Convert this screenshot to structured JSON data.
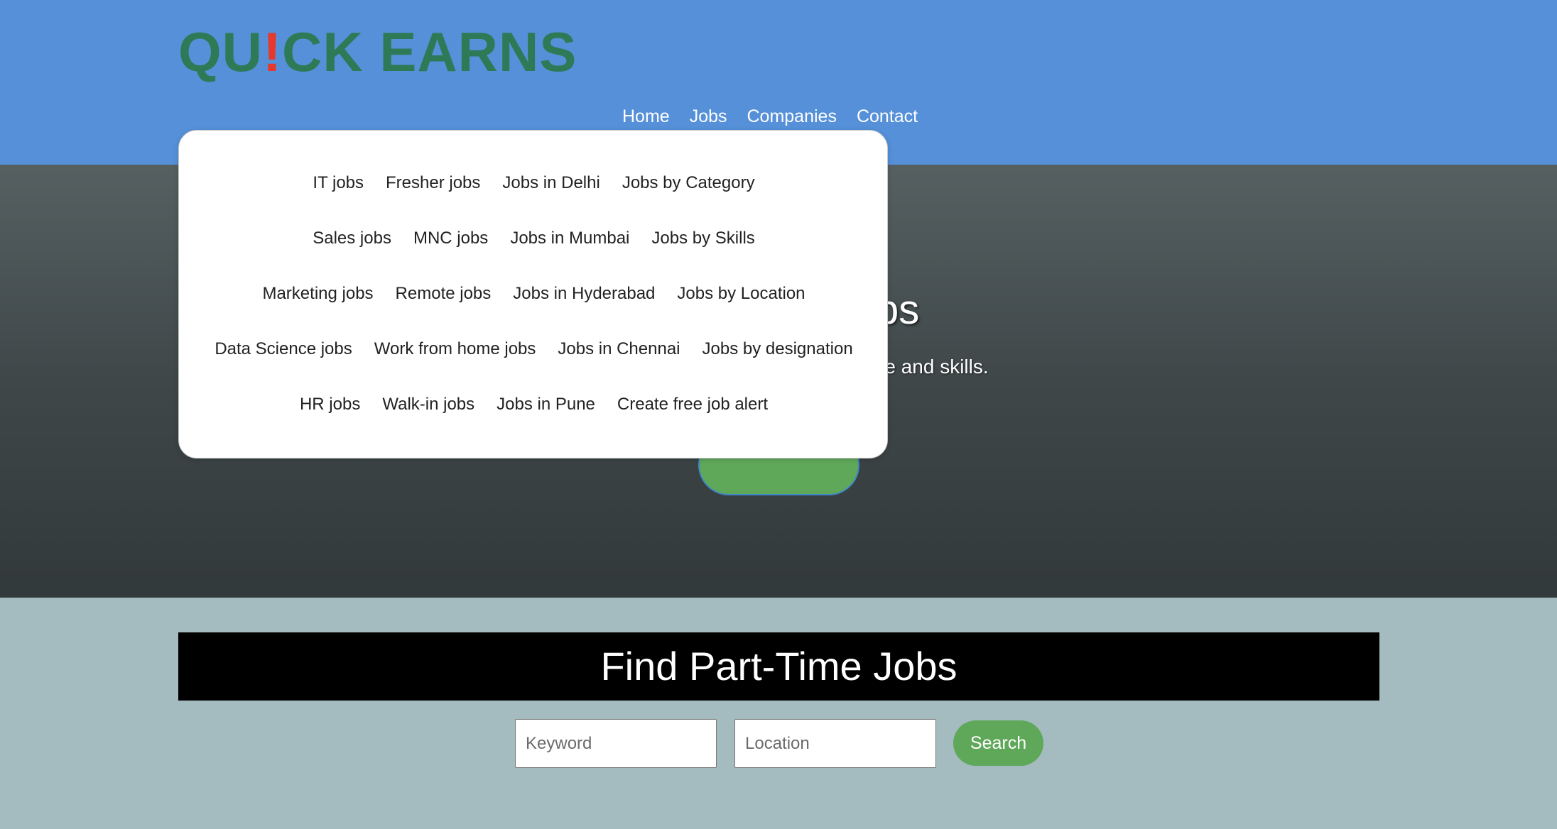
{
  "header": {
    "logo_prefix": "QU",
    "logo_bang": "!",
    "logo_suffix": "CK EARNS",
    "nav": [
      "Home",
      "Jobs",
      "Companies",
      "Contact"
    ]
  },
  "hero": {
    "title_visible": "me Jobs",
    "subtitle_visible": "dule and skills."
  },
  "dropdown": {
    "rows": [
      [
        "IT jobs",
        "Fresher jobs",
        "Jobs in Delhi",
        "Jobs by Category"
      ],
      [
        "Sales jobs",
        "MNC jobs",
        "Jobs in Mumbai",
        "Jobs by Skills"
      ],
      [
        "Marketing jobs",
        "Remote jobs",
        "Jobs in Hyderabad",
        "Jobs by Location"
      ],
      [
        "Data Science jobs",
        "Work from home jobs",
        "Jobs in Chennai",
        "Jobs by designation"
      ],
      [
        "HR jobs",
        "Walk-in jobs",
        "Jobs in Pune",
        "Create free job alert"
      ]
    ]
  },
  "search": {
    "title": "Find Part-Time Jobs",
    "keyword_placeholder": "Keyword",
    "location_placeholder": "Location",
    "button_label": "Search"
  },
  "colors": {
    "header_bg": "#5590d9",
    "logo_green": "#2e7a56",
    "logo_red": "#e8372b",
    "accent_green": "#5fa85a",
    "search_section_bg": "#a4bbbf"
  }
}
